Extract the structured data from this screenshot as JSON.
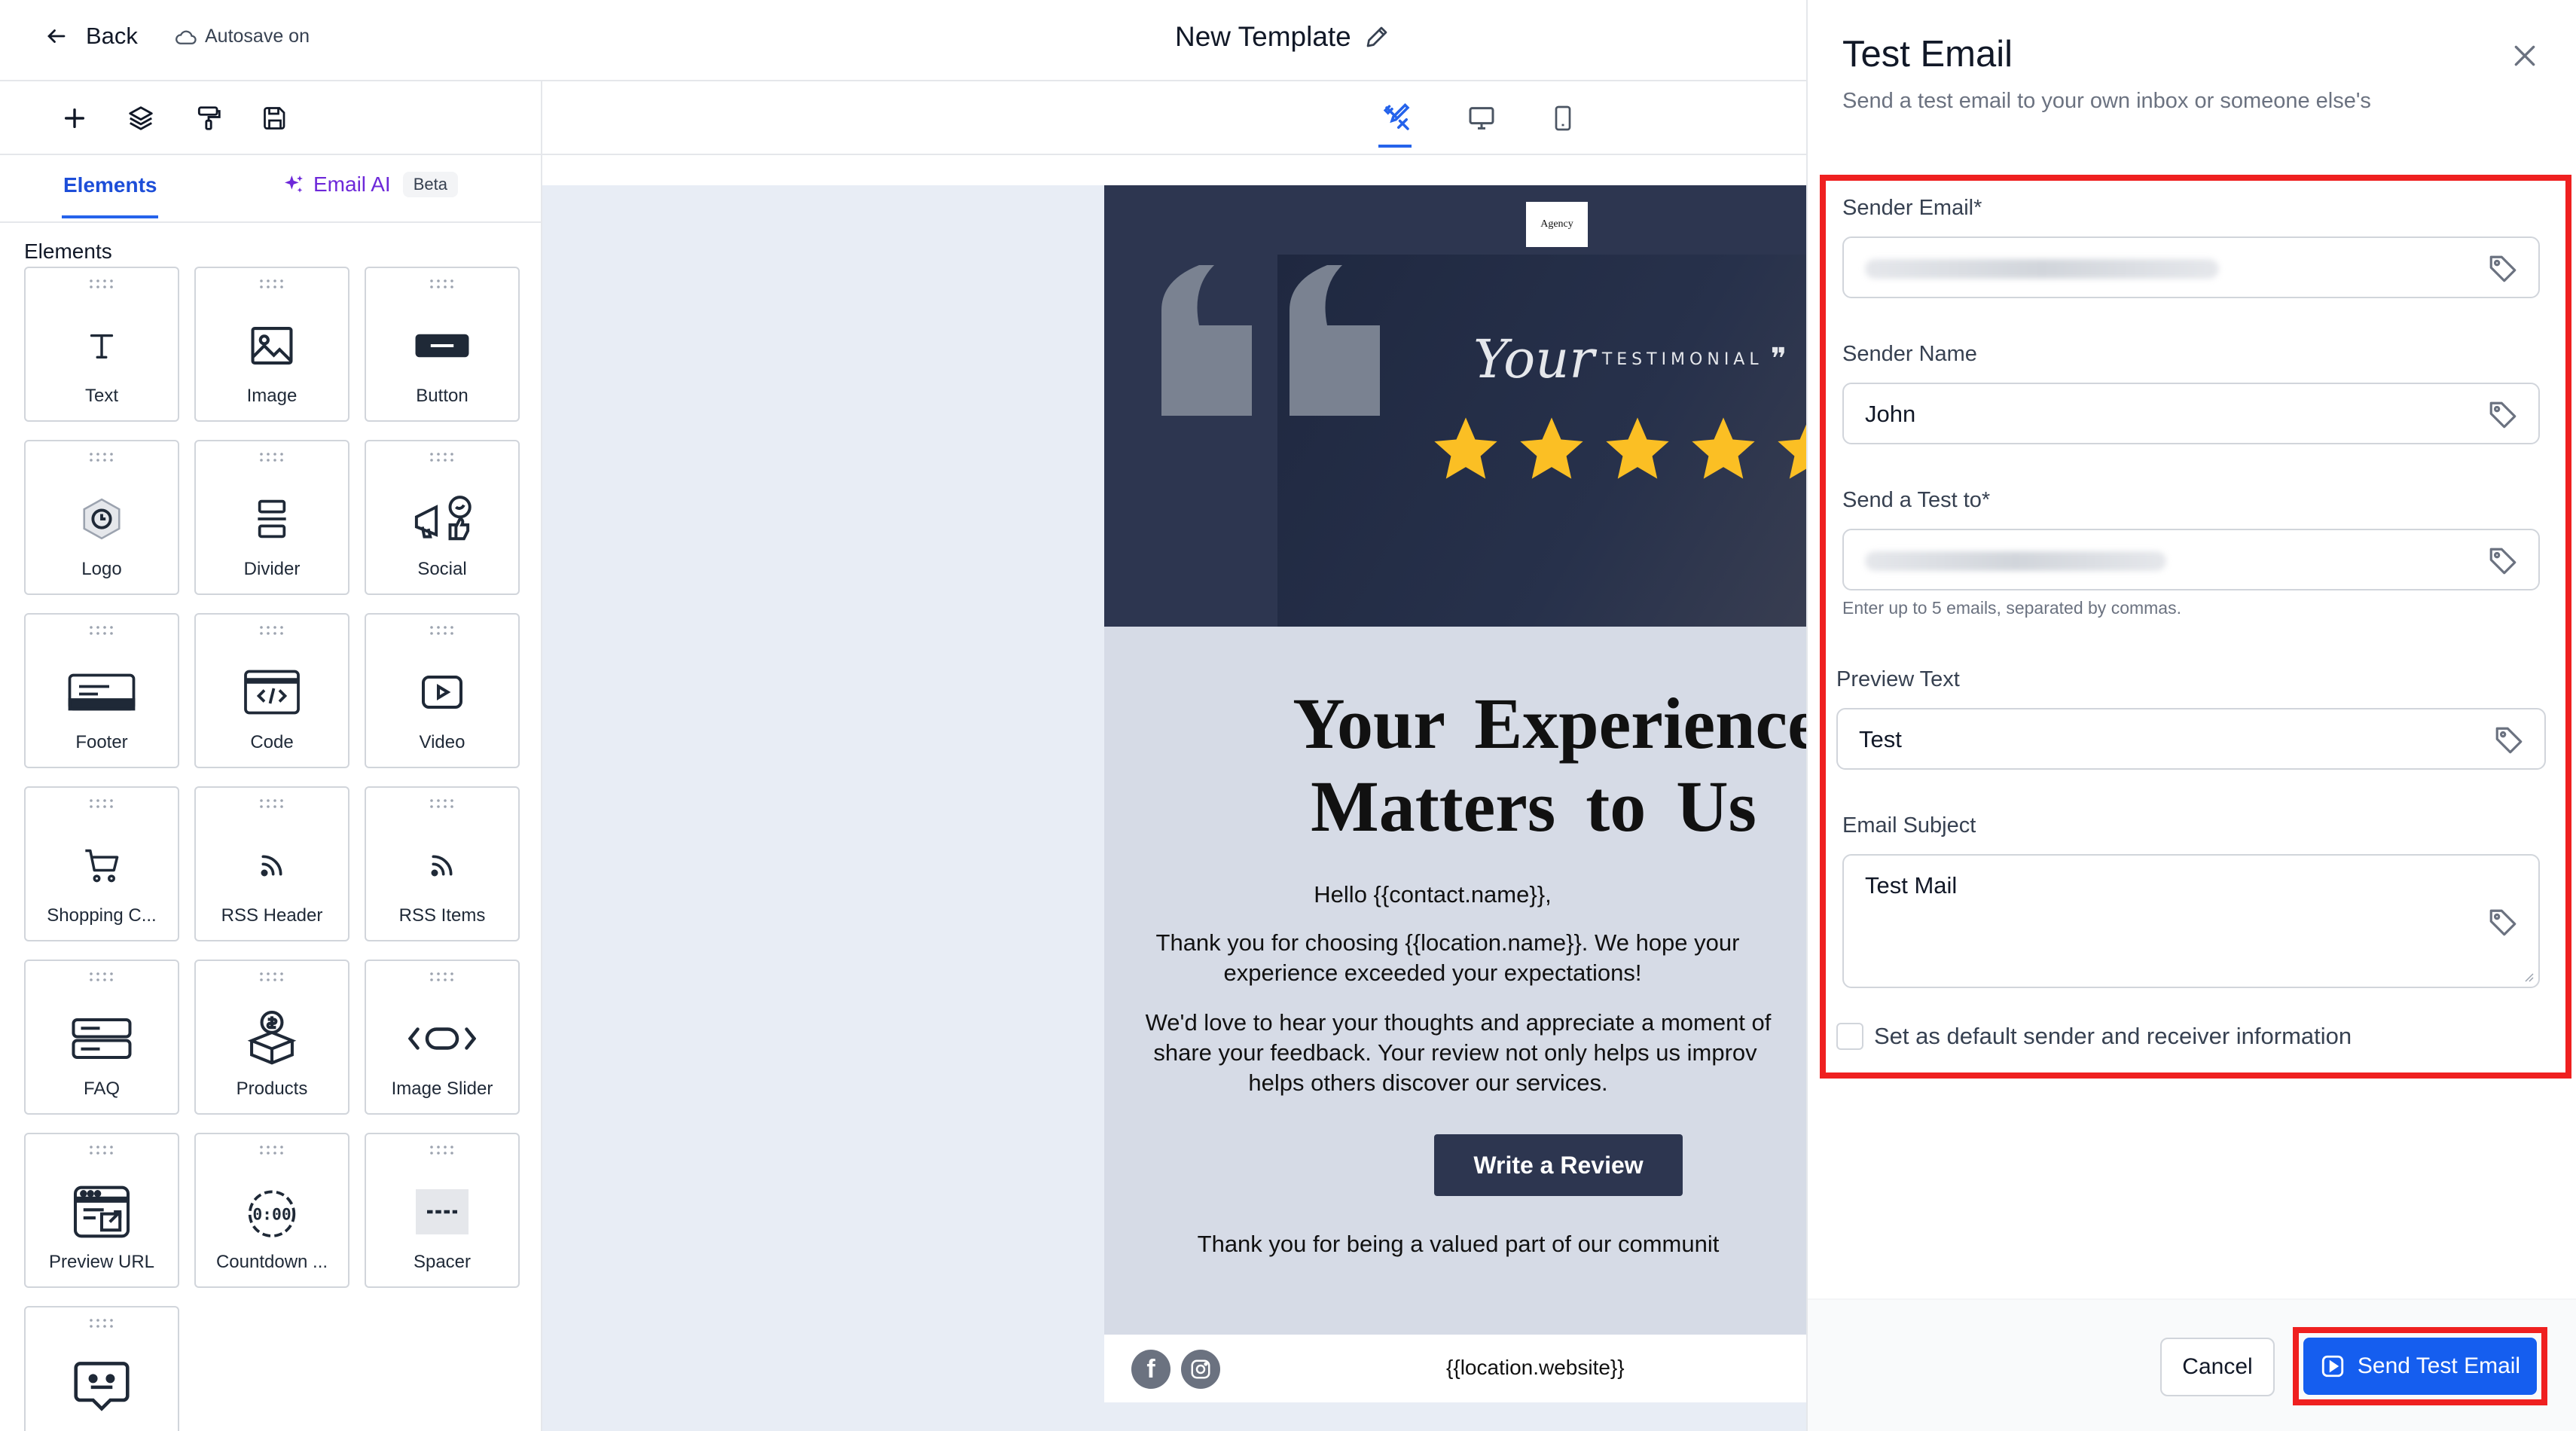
{
  "header": {
    "back_label": "Back",
    "autosave_label": "Autosave on",
    "title": "New Template"
  },
  "left_panel": {
    "tabs": {
      "elements": "Elements",
      "email_ai": "Email AI",
      "beta": "Beta"
    },
    "section_title": "Elements",
    "tiles": [
      {
        "label": "Text",
        "icon": "text-icon"
      },
      {
        "label": "Image",
        "icon": "image-icon"
      },
      {
        "label": "Button",
        "icon": "button-icon"
      },
      {
        "label": "Logo",
        "icon": "logo-icon"
      },
      {
        "label": "Divider",
        "icon": "divider-icon"
      },
      {
        "label": "Social",
        "icon": "social-icon"
      },
      {
        "label": "Footer",
        "icon": "footer-icon"
      },
      {
        "label": "Code",
        "icon": "code-icon"
      },
      {
        "label": "Video",
        "icon": "video-icon"
      },
      {
        "label": "Shopping C...",
        "icon": "cart-icon"
      },
      {
        "label": "RSS Header",
        "icon": "rss-icon"
      },
      {
        "label": "RSS Items",
        "icon": "rss-icon"
      },
      {
        "label": "FAQ",
        "icon": "faq-icon"
      },
      {
        "label": "Products",
        "icon": "products-icon"
      },
      {
        "label": "Image Slider",
        "icon": "slider-icon"
      },
      {
        "label": "Preview URL",
        "icon": "preview-url-icon"
      },
      {
        "label": "Countdown ...",
        "icon": "countdown-icon"
      },
      {
        "label": "Spacer",
        "icon": "spacer-icon"
      }
    ]
  },
  "email": {
    "logo_text": "Agency",
    "testimonial_script": "Your",
    "testimonial_word": "TESTIMONIAL",
    "headline_1": "Your Experience",
    "headline_2": "Matters to Us",
    "greeting": "Hello {{contact.name}},",
    "para1_line1": "Thank you for choosing {{location.name}}. We hope your",
    "para1_line2": "experience exceeded your expectations!",
    "para2_line1": "We'd love to hear your thoughts and appreciate a moment of",
    "para2_line2": "share your feedback. Your review not only helps us improv",
    "para2_line3": "helps others discover our services.",
    "button": "Write a Review",
    "closing": "Thank you for being a valued part of our communit",
    "website": "{{location.website}}"
  },
  "drawer": {
    "title": "Test Email",
    "subtitle": "Send a test email to your own inbox or someone else's",
    "sender_email_label": "Sender Email*",
    "sender_name_label": "Sender Name",
    "sender_name_value": "John",
    "send_to_label": "Send a Test to*",
    "send_to_hint": "Enter up to 5 emails, separated by commas.",
    "preview_label": "Preview Text",
    "preview_value": "Test",
    "subject_label": "Email Subject",
    "subject_value": "Test Mail",
    "default_checkbox_label": "Set as default sender and receiver information",
    "cancel": "Cancel",
    "send": "Send Test Email"
  },
  "colors": {
    "accent": "#155eef",
    "highlight": "#ef2020",
    "email_dark": "#2d3650",
    "star": "#fbbf24"
  }
}
